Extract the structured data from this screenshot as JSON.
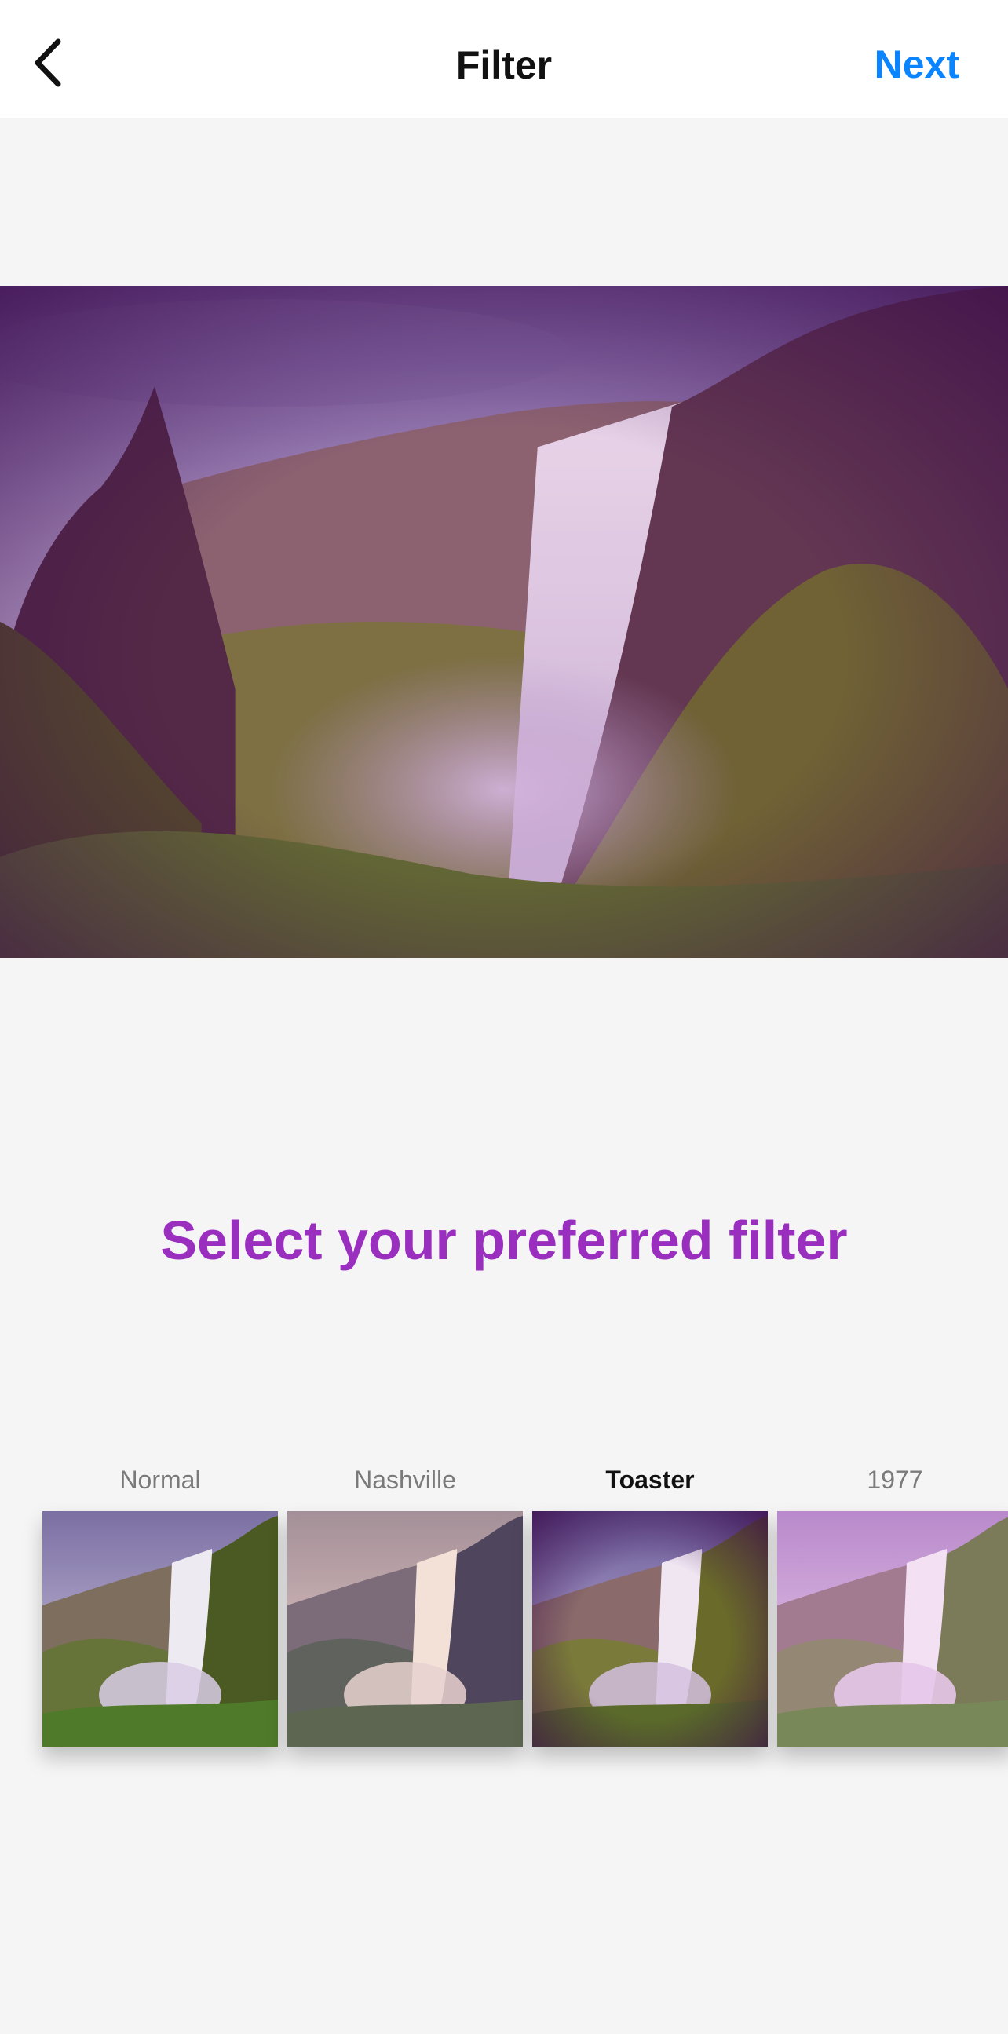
{
  "header": {
    "back_icon": "chevron-left-icon",
    "title": "Filter",
    "next_label": "Next"
  },
  "prompt": "Select your preferred filter",
  "filters": [
    {
      "label": "Normal",
      "selected": false
    },
    {
      "label": "Nashville",
      "selected": false
    },
    {
      "label": "Toaster",
      "selected": true
    },
    {
      "label": "1977",
      "selected": false
    }
  ],
  "colors": {
    "accent": "#0a84ff",
    "prompt": "#9a2fbf",
    "background": "#f5f5f5"
  }
}
